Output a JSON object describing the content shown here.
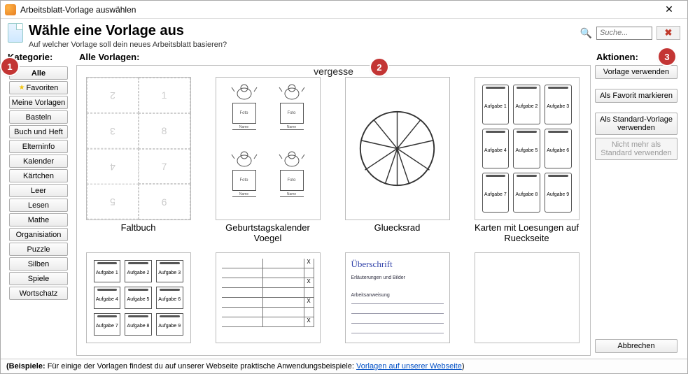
{
  "window": {
    "title": "Arbeitsblatt-Vorlage auswählen"
  },
  "header": {
    "title": "Wähle eine Vorlage aus",
    "subtitle": "Auf welcher Vorlage soll dein neues Arbeitsblatt basieren?"
  },
  "search": {
    "placeholder": "Suche..."
  },
  "categories_heading": "Kategorie:",
  "categories": [
    "Alle",
    "Favoriten",
    "Meine Vorlagen",
    "Basteln",
    "Buch und Heft",
    "Elterninfo",
    "Kalender",
    "Kärtchen",
    "Leer",
    "Lesen",
    "Mathe",
    "Organisiation",
    "Puzzle",
    "Silben",
    "Spiele",
    "Wortschatz"
  ],
  "templates_heading": "Alle Vorlagen:",
  "top_cut_label": "vergesse",
  "templates_row1": [
    {
      "label": "Faltbuch"
    },
    {
      "label": "Geburtstagskalender Voegel"
    },
    {
      "label": "Gluecksrad"
    },
    {
      "label": "Karten mit Loesungen auf Rueckseite"
    }
  ],
  "karten_cells": [
    "Aufgabe 1",
    "Aufgabe 2",
    "Aufgabe 3",
    "Aufgabe 4",
    "Aufgabe 5",
    "Aufgabe 6",
    "Aufgabe 7",
    "Aufgabe 8",
    "Aufgabe 9"
  ],
  "vogel_foto": "Foto",
  "vogel_name": "Name",
  "ueberschrift_title": "Überschrift",
  "ueberschrift_sub": "Erläuterungen und Bilder",
  "ueberschrift_task": "Arbeitsanweisung",
  "actions_heading": "Aktionen:",
  "actions": {
    "use": "Vorlage verwenden",
    "fav": "Als Favorit markieren",
    "std": "Als Standard-Vorlage verwenden",
    "unstd": "Nicht mehr als Standard verwenden",
    "cancel": "Abbrechen"
  },
  "footer": {
    "label": "(Beispiele:",
    "text": " Für einige der Vorlagen findest du auf unserer Webseite praktische Anwendungsbeispiele: ",
    "link": "Vorlagen auf unserer Webseite",
    "close": ")"
  },
  "badges": {
    "b1": "1",
    "b2": "2",
    "b3": "3"
  }
}
